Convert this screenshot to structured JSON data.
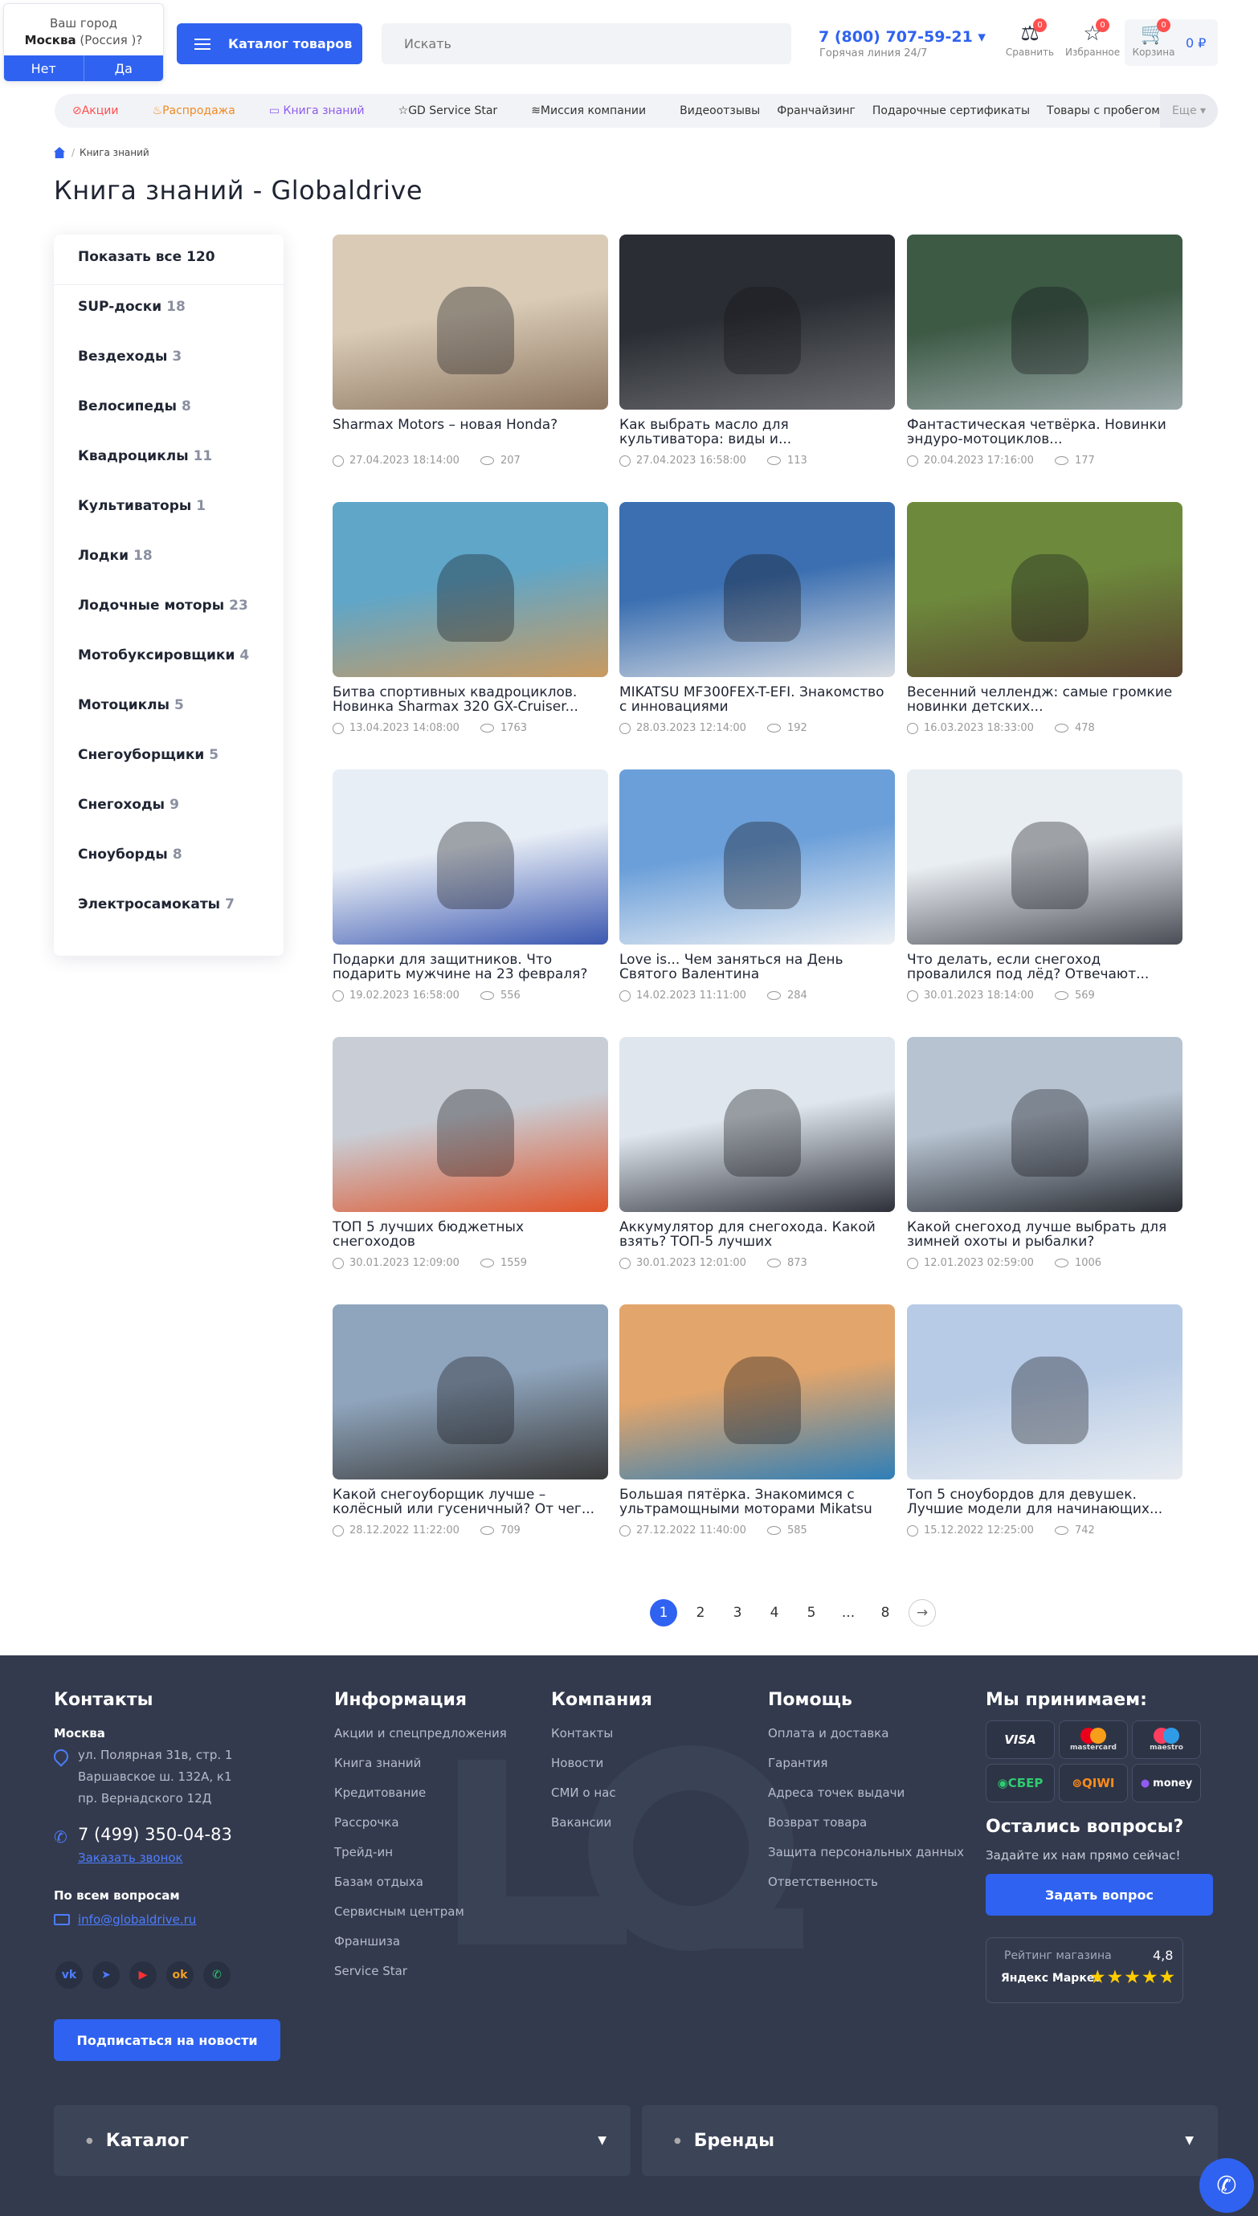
{
  "city_popup": {
    "prefix": "Ваш город",
    "city": "Москва",
    "region": "(Россия )?",
    "no": "Нет",
    "yes": "Да"
  },
  "header": {
    "catalog": "Каталог товаров",
    "search_placeholder": "Искать",
    "phone": "7 (800) 707-59-21 ▾",
    "hotline": "Горячая линия 24/7",
    "compare": {
      "label": "Сравнить",
      "count": "0"
    },
    "favorites": {
      "label": "Избранное",
      "count": "0"
    },
    "cart": {
      "label": "Корзина",
      "count": "0",
      "total": "0 ₽"
    }
  },
  "nav": {
    "items": [
      "Акции",
      "Распродажа",
      "Книга знаний",
      "GD Service Star",
      "Миссия компании",
      "Видеоотзывы",
      "Франчайзинг",
      "Подарочные сертификаты",
      "Товары с пробегом"
    ],
    "more": "Еще ▾"
  },
  "breadcrumb": {
    "current": "Книга знаний"
  },
  "page_title": "Книга знаний - Globaldrive",
  "sidebar": {
    "show_all": "Показать все 120",
    "categories": [
      {
        "name": "SUP-доски",
        "count": "18"
      },
      {
        "name": "Вездеходы",
        "count": "3"
      },
      {
        "name": "Велосипеды",
        "count": "8"
      },
      {
        "name": "Квадроциклы",
        "count": "11"
      },
      {
        "name": "Культиваторы",
        "count": "1"
      },
      {
        "name": "Лодки",
        "count": "18"
      },
      {
        "name": "Лодочные моторы",
        "count": "23"
      },
      {
        "name": "Мотобуксировщики",
        "count": "4"
      },
      {
        "name": "Мотоциклы",
        "count": "5"
      },
      {
        "name": "Снегоуборщики",
        "count": "5"
      },
      {
        "name": "Снегоходы",
        "count": "9"
      },
      {
        "name": "Сноуборды",
        "count": "8"
      },
      {
        "name": "Электросамокаты",
        "count": "7"
      }
    ]
  },
  "articles": [
    {
      "title": "Sharmax Motors – новая Honda?",
      "date": "27.04.2023 18:14:00",
      "views": "207",
      "c1": "#d9cbb6",
      "c2": "#8c7560"
    },
    {
      "title": "Как выбрать масло для культиватора: виды и...",
      "date": "27.04.2023 16:58:00",
      "views": "113",
      "c1": "#2a2d33",
      "c2": "#6a6c70"
    },
    {
      "title": "Фантастическая четвёрка. Новинки эндуро-мотоциклов...",
      "date": "20.04.2023 17:16:00",
      "views": "177",
      "c1": "#3d5a45",
      "c2": "#9aa7a8"
    },
    {
      "title": "Битва спортивных квадроциклов. Новинка Sharmax 320 GX-Cruiser...",
      "date": "13.04.2023 14:08:00",
      "views": "1763",
      "c1": "#5fa6c9",
      "c2": "#c99a60"
    },
    {
      "title": "MIKATSU MF300FEX-T-EFI. Знакомство с инновациями",
      "date": "28.03.2023 12:14:00",
      "views": "192",
      "c1": "#3b6fb1",
      "c2": "#d9dde3"
    },
    {
      "title": "Весенний челлендж: самые громкие новинки детских...",
      "date": "16.03.2023 18:33:00",
      "views": "478",
      "c1": "#6d8a3c",
      "c2": "#5a4330"
    },
    {
      "title": "Подарки для защитников. Что подарить мужчине на 23 февраля?",
      "date": "19.02.2023 16:58:00",
      "views": "556",
      "c1": "#e8eef6",
      "c2": "#3c58b0"
    },
    {
      "title": "Love is... Чем заняться на День Святого Валентина",
      "date": "14.02.2023 11:11:00",
      "views": "284",
      "c1": "#6b9fd9",
      "c2": "#eef1f5"
    },
    {
      "title": "Что делать, если снегоход провалился под лёд? Отвечают...",
      "date": "30.01.2023 18:14:00",
      "views": "569",
      "c1": "#e9eef3",
      "c2": "#4a4d55"
    },
    {
      "title": "ТОП 5 лучших бюджетных снегоходов",
      "date": "30.01.2023 12:09:00",
      "views": "1559",
      "c1": "#c9ced6",
      "c2": "#e0542a"
    },
    {
      "title": "Аккумулятор для снегохода. Какой взять? ТОП-5 лучших",
      "date": "30.01.2023 12:01:00",
      "views": "873",
      "c1": "#dfe6ee",
      "c2": "#2d3038"
    },
    {
      "title": "Какой снегоход лучше выбрать для зимней охоты и рыбалки?",
      "date": "12.01.2023 02:59:00",
      "views": "1006",
      "c1": "#b7c3d1",
      "c2": "#2a2d33"
    },
    {
      "title": "Какой снегоуборщик лучше – колёсный или гусеничный? От чег...",
      "date": "28.12.2022 11:22:00",
      "views": "709",
      "c1": "#8fa5bd",
      "c2": "#3a3a3a"
    },
    {
      "title": "Большая пятёрка. Знакомимся с ультрамощными моторами Mikatsu",
      "date": "27.12.2022 11:40:00",
      "views": "585",
      "c1": "#e2a56b",
      "c2": "#2f7fb8"
    },
    {
      "title": "Топ 5 сноубордов для девушек. Лучшие модели для начинающих...",
      "date": "15.12.2022 12:25:00",
      "views": "742",
      "c1": "#b7cbe6",
      "c2": "#e8ecf1"
    }
  ],
  "pagination": {
    "pages": [
      "1",
      "2",
      "3",
      "4",
      "5",
      "...",
      "8"
    ],
    "next": "→",
    "current": "1"
  },
  "footer": {
    "contacts": {
      "title": "Контакты",
      "city": "Москва",
      "addresses": [
        "ул. Полярная 31в, стр. 1",
        "Варшавское ш. 132А, к1",
        "пр. Вернадского 12Д"
      ],
      "phone": "7 (499) 350-04-83",
      "callback": "Заказать звонок",
      "questions_label": "По всем вопросам",
      "email": "info@globaldrive.ru",
      "subscribe": "Подписаться на новости"
    },
    "info": {
      "title": "Информация",
      "links": [
        "Акции и спецпредложения",
        "Книга знаний",
        "Кредитование",
        "Рассрочка",
        "Трейд-ин",
        "Базам отдыха",
        "Сервисным центрам",
        "Франшиза",
        "Service Star"
      ]
    },
    "company": {
      "title": "Компания",
      "links": [
        "Контакты",
        "Новости",
        "СМИ о нас",
        "Вакансии"
      ]
    },
    "help": {
      "title": "Помощь",
      "links": [
        "Оплата и доставка",
        "Гарантия",
        "Адреса точек выдачи",
        "Возврат товара",
        "Защита персональных данных",
        "Ответственность"
      ]
    },
    "payments": {
      "title": "Мы принимаем:",
      "methods": [
        "VISA",
        "mastercard",
        "maestro",
        "СБЕР",
        "QIWI",
        "money"
      ]
    },
    "questions": {
      "title": "Остались вопросы?",
      "subtitle": "Задайте их нам прямо сейчас!",
      "button": "Задать вопрос"
    },
    "rating": {
      "label": "Рейтинг магазина",
      "value": "4,8",
      "source": "Яндекс Маркет",
      "stars": 4.8
    },
    "accordions": [
      "Каталог",
      "Бренды"
    ]
  }
}
